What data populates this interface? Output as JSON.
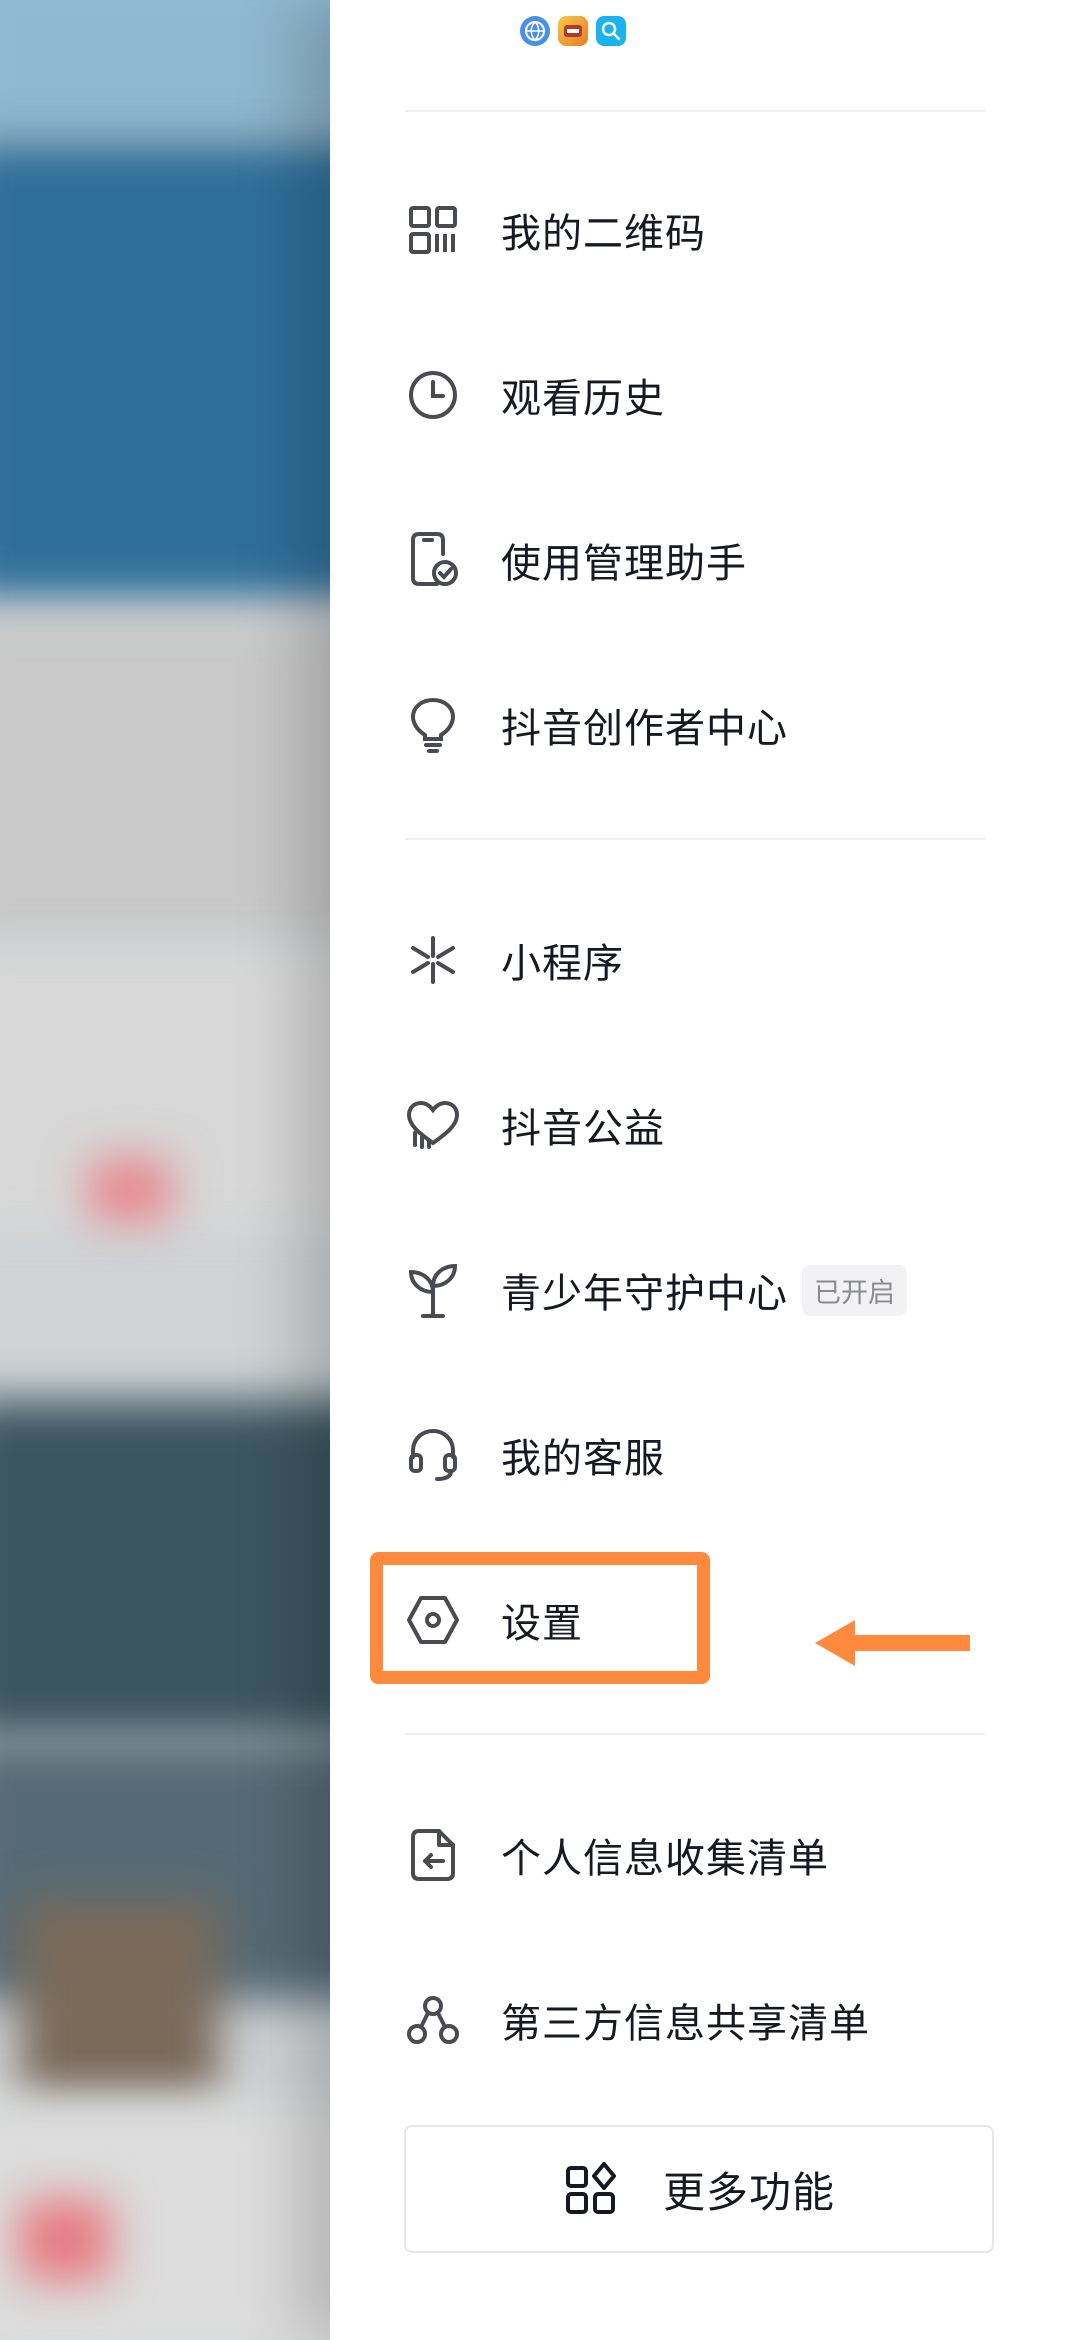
{
  "menu": {
    "items": [
      {
        "label": "我的二维码",
        "icon": "qr-code-icon"
      },
      {
        "label": "观看历史",
        "icon": "clock-icon"
      },
      {
        "label": "使用管理助手",
        "icon": "phone-check-icon"
      },
      {
        "label": "抖音创作者中心",
        "icon": "lightbulb-icon"
      },
      {
        "label": "小程序",
        "icon": "mini-program-icon"
      },
      {
        "label": "抖音公益",
        "icon": "heart-hand-icon"
      },
      {
        "label": "青少年守护中心",
        "icon": "sprout-icon",
        "badge": "已开启"
      },
      {
        "label": "我的客服",
        "icon": "headset-icon"
      },
      {
        "label": "设置",
        "icon": "settings-hexagon-icon"
      },
      {
        "label": "个人信息收集清单",
        "icon": "document-arrow-icon"
      },
      {
        "label": "第三方信息共享清单",
        "icon": "share-nodes-icon"
      }
    ]
  },
  "more": {
    "label": "更多功能",
    "icon": "grid-apps-icon"
  },
  "top_apps": {
    "icons": [
      "globe-app-icon",
      "game-app-icon",
      "search-app-icon"
    ]
  },
  "annotation": {
    "highlight_color": "#ff8a3d",
    "target": "设置"
  },
  "colors": {
    "text": "#161823",
    "icon": "#4a4b52",
    "badge_text": "#8a8b91",
    "badge_bg": "#f2f2f4"
  }
}
